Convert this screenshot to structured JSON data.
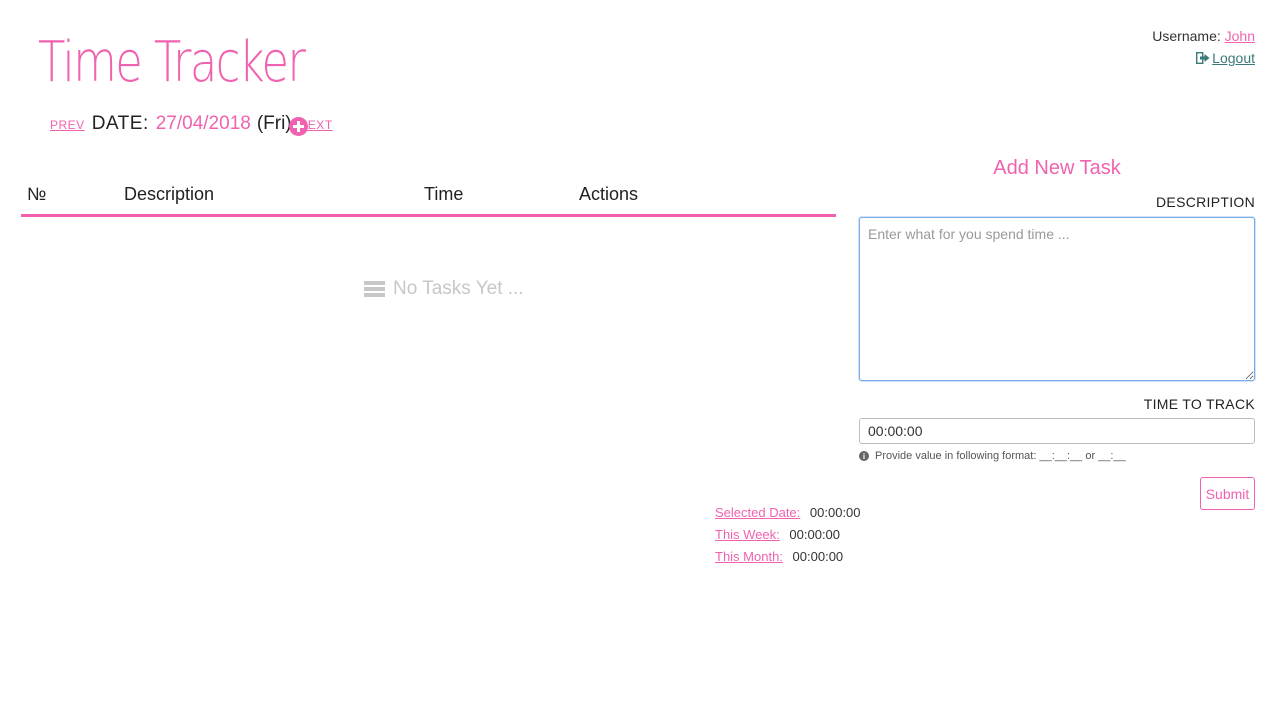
{
  "header": {
    "title": "Time Tracker",
    "username_label": "Username:",
    "username": "John",
    "logout_label": "Logout"
  },
  "date_nav": {
    "prev_label": "PREV",
    "date_label": "DATE:",
    "date_value": "27/04/2018",
    "day_value": "(Fri)",
    "next_label": "NEXT",
    "add_icon": "plus-circle-icon"
  },
  "table": {
    "columns": [
      "№",
      "Description",
      "Time",
      "Actions"
    ],
    "empty_text": "No Tasks Yet ..."
  },
  "totals": {
    "selected_date_label": "Selected Date:",
    "selected_date_value": "00:00:00",
    "this_week_label": "This Week:",
    "this_week_value": "00:00:00",
    "this_month_label": "This Month:",
    "this_month_value": "00:00:00"
  },
  "form": {
    "title": "Add New Task",
    "description_label": "DESCRIPTION",
    "description_placeholder": "Enter what for you spend time ...",
    "description_value": "",
    "time_label": "TIME TO TRACK",
    "time_value": "00:00:00",
    "hint": "Provide value in following format: __:__:__ or __:__",
    "submit_label": "Submit"
  },
  "colors": {
    "accent": "#f062b0",
    "logout": "#3a7a7a",
    "muted": "#c7c7c7"
  }
}
